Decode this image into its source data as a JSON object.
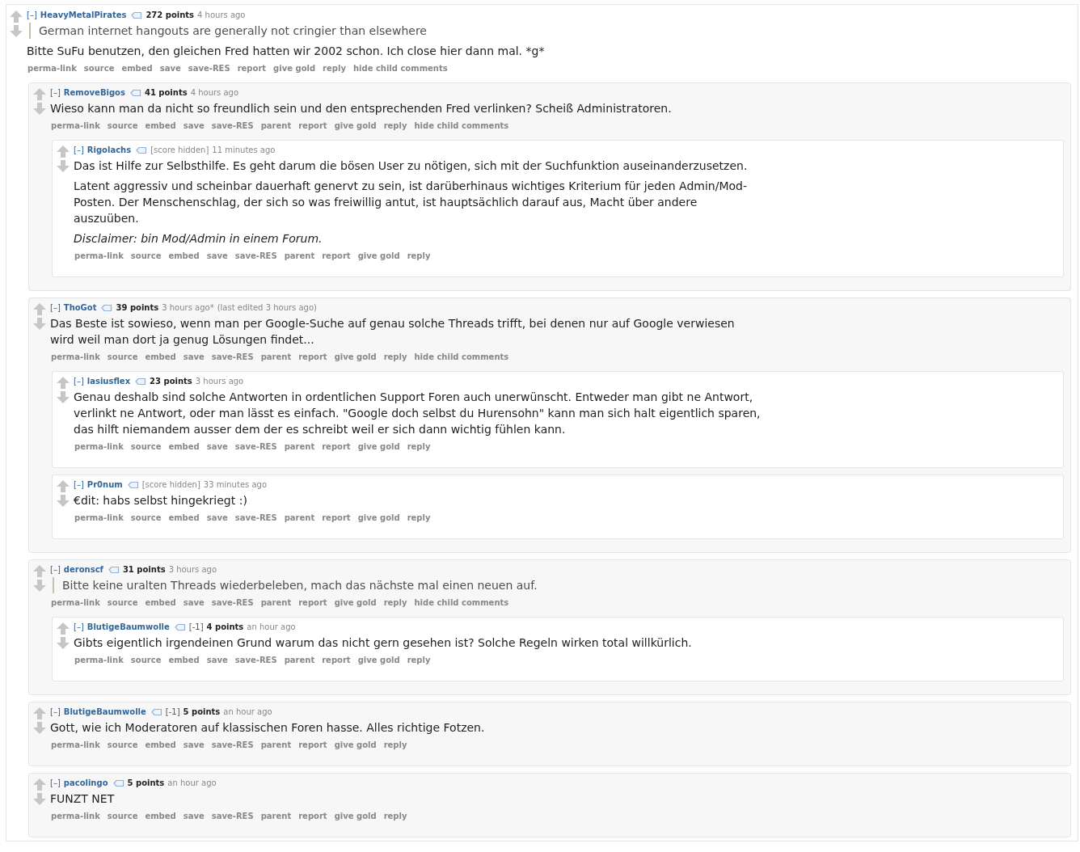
{
  "comments": [
    {
      "toggle": "[–]",
      "author": "HeavyMetalPirates",
      "score": "272 points",
      "score_hidden": false,
      "time": "4 hours ago",
      "body": [
        {
          "kind": "quote",
          "text": "German internet hangouts are generally not cringier than elsewhere"
        },
        {
          "kind": "text",
          "text": "Bitte SuFu benutzen, den gleichen Fred hatten wir 2002 schon. Ich close hier dann mal. *g*"
        }
      ],
      "actions": [
        "perma-link",
        "source",
        "embed",
        "save",
        "save-RES",
        "report",
        "give gold",
        "reply",
        "hide child comments"
      ],
      "children": [
        {
          "toggle": "[–]",
          "author": "RemoveBigos",
          "score": "41 points",
          "score_hidden": false,
          "time": "4 hours ago",
          "body": [
            {
              "kind": "text",
              "text": "Wieso kann man da nicht so freundlich sein und den entsprechenden Fred verlinken? Scheiß Administratoren."
            }
          ],
          "actions": [
            "perma-link",
            "source",
            "embed",
            "save",
            "save-RES",
            "parent",
            "report",
            "give gold",
            "reply",
            "hide child comments"
          ],
          "children": [
            {
              "toggle": "[–]",
              "author": "Rigolachs",
              "score": "[score hidden]",
              "score_hidden": true,
              "time": "11 minutes ago",
              "body": [
                {
                  "kind": "text",
                  "text": "Das ist Hilfe zur Selbsthilfe. Es geht darum die bösen User zu nötigen, sich mit der Suchfunktion auseinanderzusetzen."
                },
                {
                  "kind": "text",
                  "text": "Latent aggressiv und scheinbar dauerhaft genervt zu sein, ist darüberhinaus wichtiges Kriterium für jeden Admin/Mod-Posten. Der Menschenschlag, der sich so was freiwillig antut, ist hauptsächlich darauf aus, Macht über andere auszuüben."
                },
                {
                  "kind": "italic",
                  "text": "Disclaimer: bin Mod/Admin in einem Forum."
                }
              ],
              "actions": [
                "perma-link",
                "source",
                "embed",
                "save",
                "save-RES",
                "parent",
                "report",
                "give gold",
                "reply"
              ]
            }
          ]
        },
        {
          "toggle": "[–]",
          "author": "ThoGot",
          "score": "39 points",
          "score_hidden": false,
          "time": "3 hours ago*",
          "edited": "(last edited 3 hours ago)",
          "body": [
            {
              "kind": "text",
              "text": "Das Beste ist sowieso, wenn man per Google-Suche auf genau solche Threads trifft, bei denen nur auf Google verwiesen wird weil man dort ja genug Lösungen findet..."
            }
          ],
          "actions": [
            "perma-link",
            "source",
            "embed",
            "save",
            "save-RES",
            "parent",
            "report",
            "give gold",
            "reply",
            "hide child comments"
          ],
          "children": [
            {
              "toggle": "[–]",
              "author": "lasiusflex",
              "score": "23 points",
              "score_hidden": false,
              "time": "3 hours ago",
              "body": [
                {
                  "kind": "text",
                  "text": "Genau deshalb sind solche Antworten in ordentlichen Support Foren auch unerwünscht. Entweder man gibt ne Antwort, verlinkt ne Antwort, oder man lässt es einfach. \"Google doch selbst du Hurensohn\" kann man sich halt eigentlich sparen, das hilft niemandem ausser dem der es schreibt weil er sich dann wichtig fühlen kann."
                }
              ],
              "actions": [
                "perma-link",
                "source",
                "embed",
                "save",
                "save-RES",
                "parent",
                "report",
                "give gold",
                "reply"
              ]
            },
            {
              "toggle": "[–]",
              "author": "Pr0num",
              "score": "[score hidden]",
              "score_hidden": true,
              "time": "33 minutes ago",
              "body": [
                {
                  "kind": "text",
                  "text": "€dit: habs selbst hingekriegt :)"
                }
              ],
              "actions": [
                "perma-link",
                "source",
                "embed",
                "save",
                "save-RES",
                "parent",
                "report",
                "give gold",
                "reply"
              ]
            }
          ]
        },
        {
          "toggle": "[–]",
          "author": "deronscf",
          "score": "31 points",
          "score_hidden": false,
          "time": "3 hours ago",
          "body": [
            {
              "kind": "quote",
              "text": "Bitte keine uralten Threads wiederbeleben, mach das nächste mal einen neuen auf."
            }
          ],
          "actions": [
            "perma-link",
            "source",
            "embed",
            "save",
            "save-RES",
            "parent",
            "report",
            "give gold",
            "reply",
            "hide child comments"
          ],
          "children": [
            {
              "toggle": "[–]",
              "author": "BlutigeBaumwolle",
              "flair": "[-1]",
              "score": "4 points",
              "score_hidden": false,
              "time": "an hour ago",
              "body": [
                {
                  "kind": "text",
                  "text": "Gibts eigentlich irgendeinen Grund warum das nicht gern gesehen ist? Solche Regeln wirken total willkürlich."
                }
              ],
              "actions": [
                "perma-link",
                "source",
                "embed",
                "save",
                "save-RES",
                "parent",
                "report",
                "give gold",
                "reply"
              ]
            }
          ]
        },
        {
          "toggle": "[–]",
          "author": "BlutigeBaumwolle",
          "flair": "[-1]",
          "score": "5 points",
          "score_hidden": false,
          "time": "an hour ago",
          "body": [
            {
              "kind": "text",
              "text": "Gott, wie ich Moderatoren auf klassischen Foren hasse. Alles richtige Fotzen."
            }
          ],
          "actions": [
            "perma-link",
            "source",
            "embed",
            "save",
            "save-RES",
            "parent",
            "report",
            "give gold",
            "reply"
          ]
        },
        {
          "toggle": "[–]",
          "author": "pacolingo",
          "score": "5 points",
          "score_hidden": false,
          "time": "an hour ago",
          "body": [
            {
              "kind": "text",
              "text": "FUNZT NET"
            }
          ],
          "actions": [
            "perma-link",
            "source",
            "embed",
            "save",
            "save-RES",
            "parent",
            "report",
            "give gold",
            "reply"
          ]
        }
      ]
    }
  ]
}
